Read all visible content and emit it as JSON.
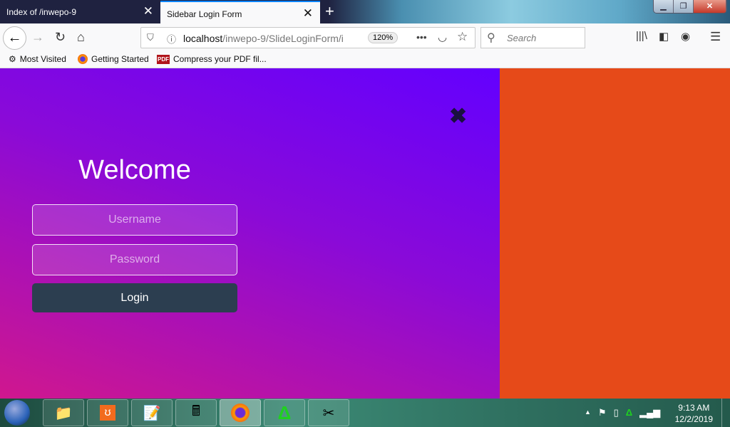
{
  "browser": {
    "tabs": [
      {
        "label": "Index of /inwepo-9",
        "active": false
      },
      {
        "label": "Sidebar Login Form",
        "active": true
      }
    ],
    "new_tab": "+",
    "url_host": "localhost",
    "url_path": "/inwepo-9/SlideLoginForm/i",
    "zoom": "120%",
    "search_placeholder": "Search",
    "bookmarks": [
      {
        "label": "Most Visited",
        "icon": "gear-icon"
      },
      {
        "label": "Getting Started",
        "icon": "firefox-icon"
      },
      {
        "label": "Compress your PDF fil...",
        "icon": "pdf-icon"
      }
    ],
    "pdf_badge": "PDF"
  },
  "page": {
    "title": "Welcome",
    "username_placeholder": "Username",
    "password_placeholder": "Password",
    "login_label": "Login",
    "colors": {
      "sidebar_top": "#6300ff",
      "sidebar_bottom": "#d0178e",
      "background": "#e64a19",
      "button": "#2c3e50"
    }
  },
  "taskbar": {
    "apps": [
      "file-explorer",
      "xampp",
      "notepad-plus-plus",
      "calculator",
      "firefox",
      "green-triangle-app",
      "snipping-tool"
    ],
    "time": "9:13 AM",
    "date": "12/2/2019"
  }
}
